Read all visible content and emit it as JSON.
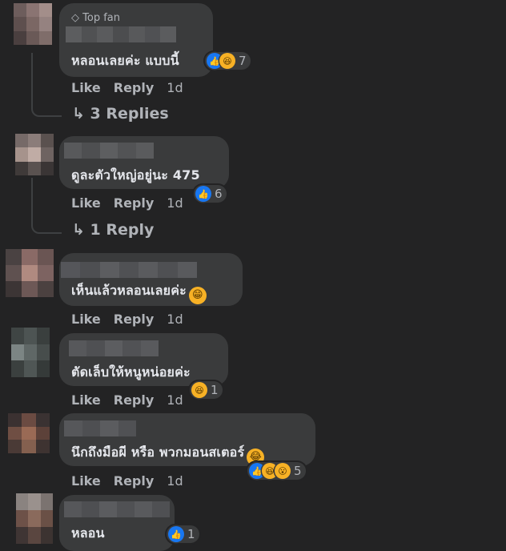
{
  "actions": {
    "like": "Like",
    "reply": "Reply"
  },
  "comments": [
    {
      "badge_icon": "diamond-icon",
      "badge": "Top fan",
      "text": "หลอนเลยค่ะ แบบนี้",
      "time": "1d",
      "reactions": [
        "like-icon",
        "haha-icon"
      ],
      "reaction_count": "7",
      "replies": "3 Replies"
    },
    {
      "text": "ดูละตัวใหญ่อยู่นะ 475",
      "time": "1d",
      "reactions": [
        "like-icon"
      ],
      "reaction_count": "6",
      "replies": "1 Reply"
    },
    {
      "text": "เห็นแล้วหลอนเลยค่ะ",
      "inline_emoji": "grin-emoji",
      "time": "1d"
    },
    {
      "text": "ตัดเล็บให้หนูหน่อยค่ะ",
      "time": "1d",
      "reactions": [
        "haha-icon"
      ],
      "reaction_count": "1"
    },
    {
      "text": "นึกถึงมือผี หรือ พวกมอนสเตอร์",
      "inline_emoji": "joy-emoji",
      "time": "1d",
      "reactions": [
        "like-icon",
        "haha-icon",
        "wow-icon"
      ],
      "reaction_count": "5"
    },
    {
      "text": "หลอน",
      "reactions": [
        "like-icon"
      ],
      "reaction_count": "1"
    }
  ],
  "colors": {
    "background": "#232324",
    "bubble": "#3a3b3c",
    "text": "#e4e6eb",
    "muted": "#b0b3b8",
    "like_blue": "#1877f2",
    "emoji_yellow": "#f7b125"
  }
}
